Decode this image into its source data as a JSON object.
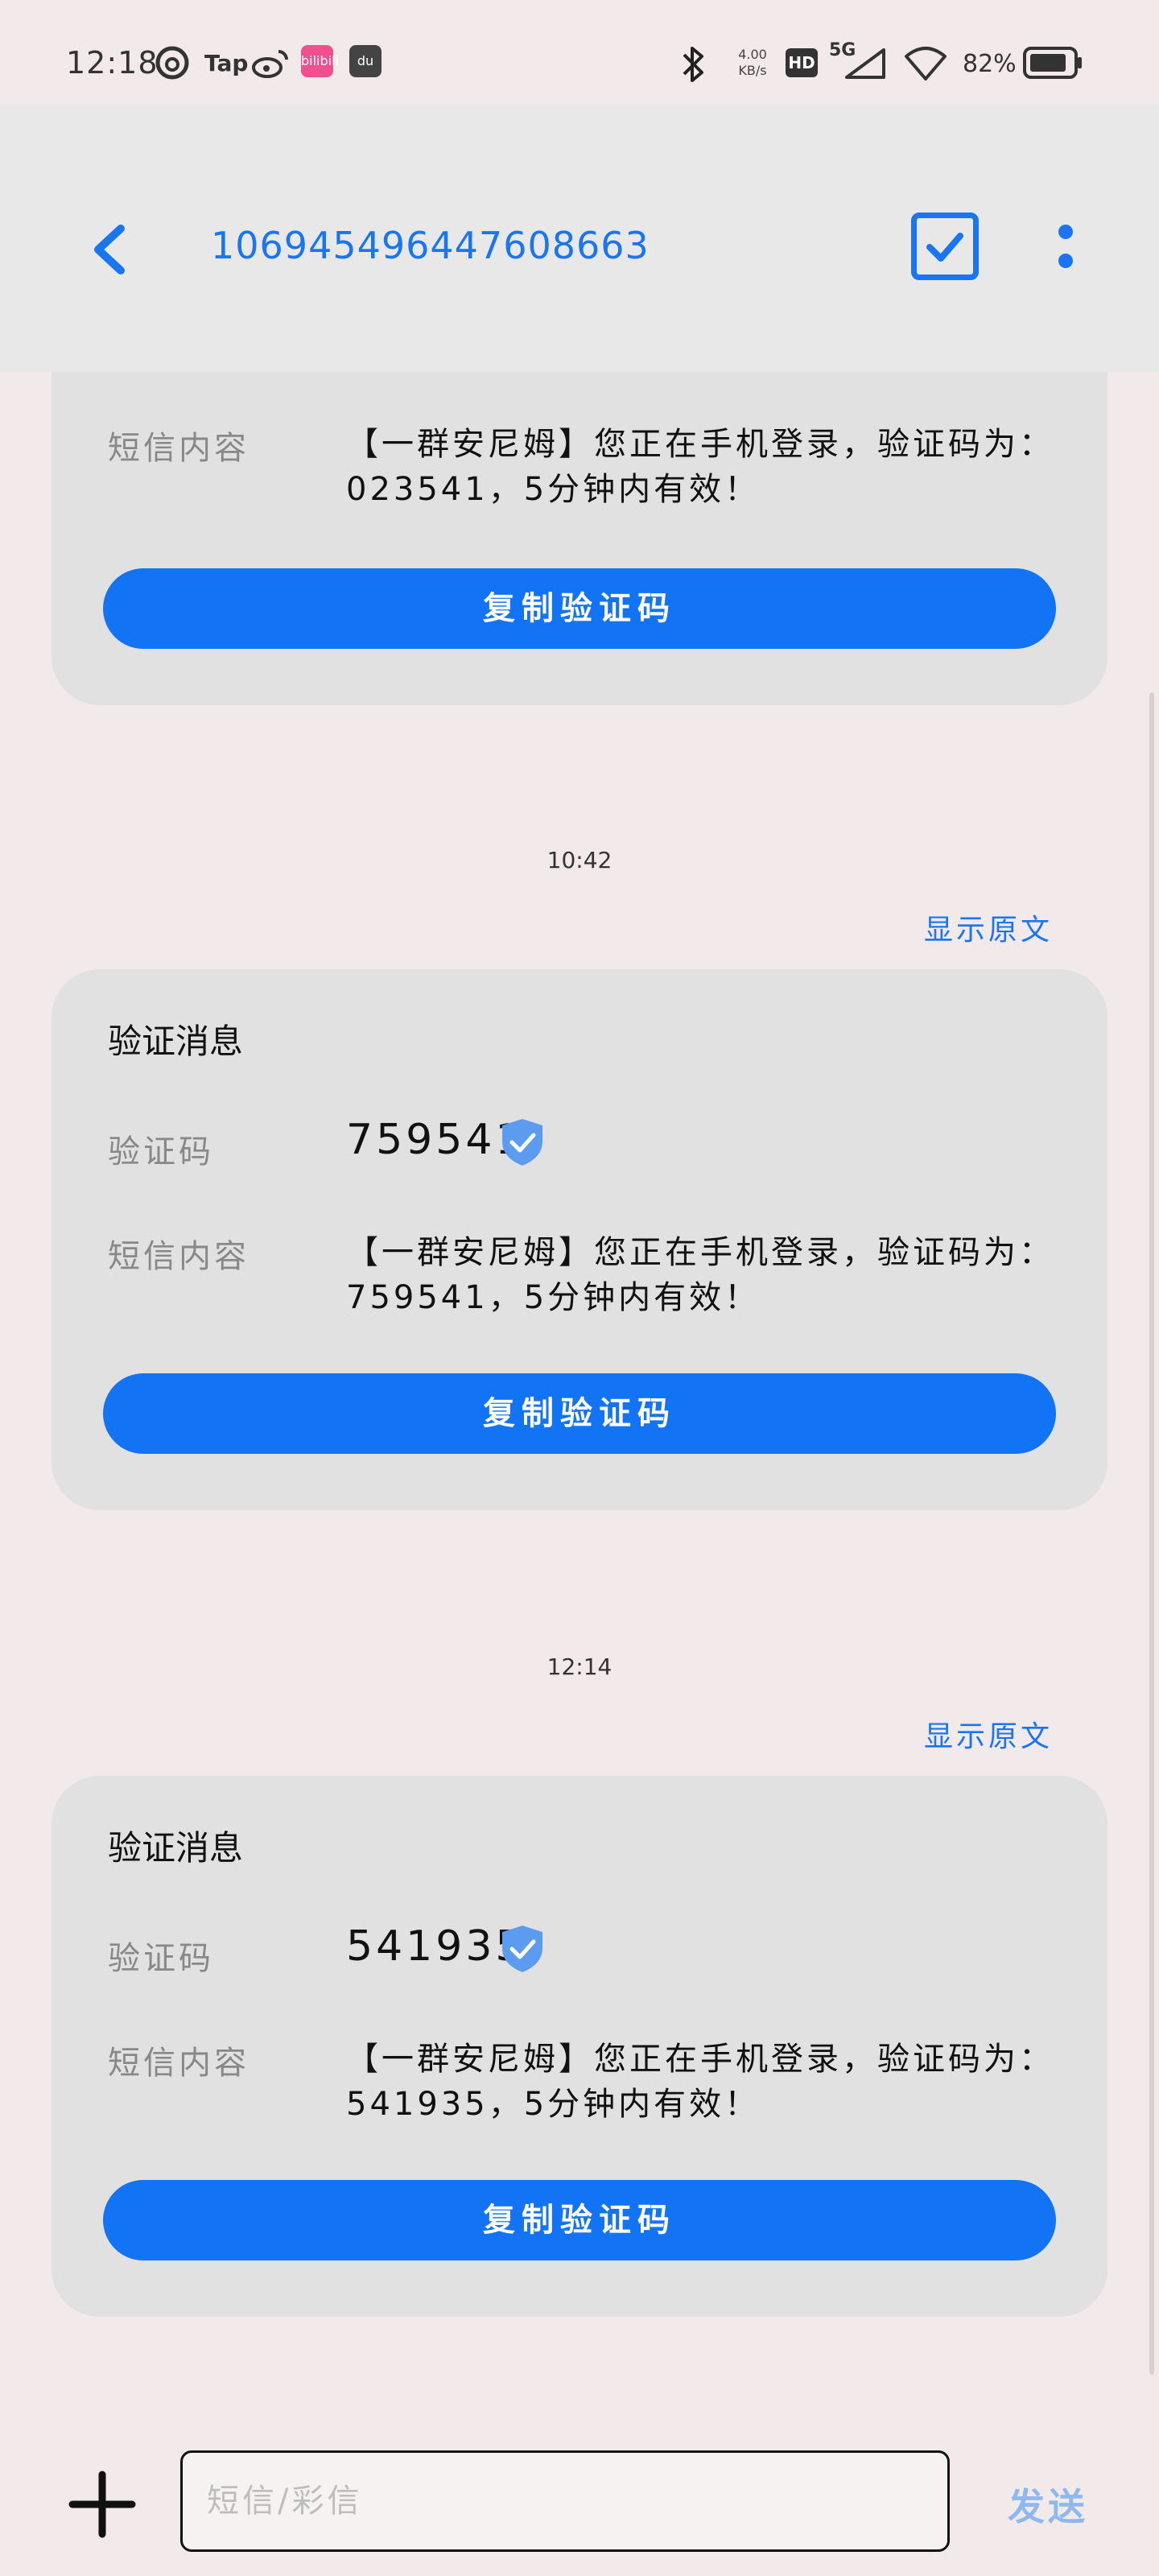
{
  "status_bar": {
    "time": "12:18",
    "tap_label": "Tap",
    "net_speed_value": "4.00",
    "net_speed_unit": "KB/s",
    "hd_label": "HD",
    "network_label": "5G",
    "battery_percent": "82%",
    "badge_1_text": "bilibili",
    "badge_2_text": "du"
  },
  "header": {
    "title": "106945496447608663"
  },
  "messages": [
    {
      "sms_label": "短信内容",
      "sms_content": "【一群安尼姆】您正在手机登录，验证码为：023541，5分钟内有效！",
      "copy_label": "复制验证码"
    },
    {
      "timestamp": "10:42",
      "show_original": "显示原文",
      "title": "验证消息",
      "code_label": "验证码",
      "code": "759541",
      "sms_label": "短信内容",
      "sms_content": "【一群安尼姆】您正在手机登录，验证码为：759541，5分钟内有效！",
      "copy_label": "复制验证码"
    },
    {
      "timestamp": "12:14",
      "show_original": "显示原文",
      "title": "验证消息",
      "code_label": "验证码",
      "code": "541935",
      "sms_label": "短信内容",
      "sms_content": "【一群安尼姆】您正在手机登录，验证码为：541935，5分钟内有效！",
      "copy_label": "复制验证码"
    }
  ],
  "composer": {
    "placeholder": "短信/彩信",
    "send_label": "发送"
  },
  "colors": {
    "accent": "#1976f0",
    "button": "#1273f5",
    "card": "#e2e1e2",
    "background": "#f2eaea",
    "header": "#e9e8e9",
    "verified": "#5b9cf0"
  }
}
